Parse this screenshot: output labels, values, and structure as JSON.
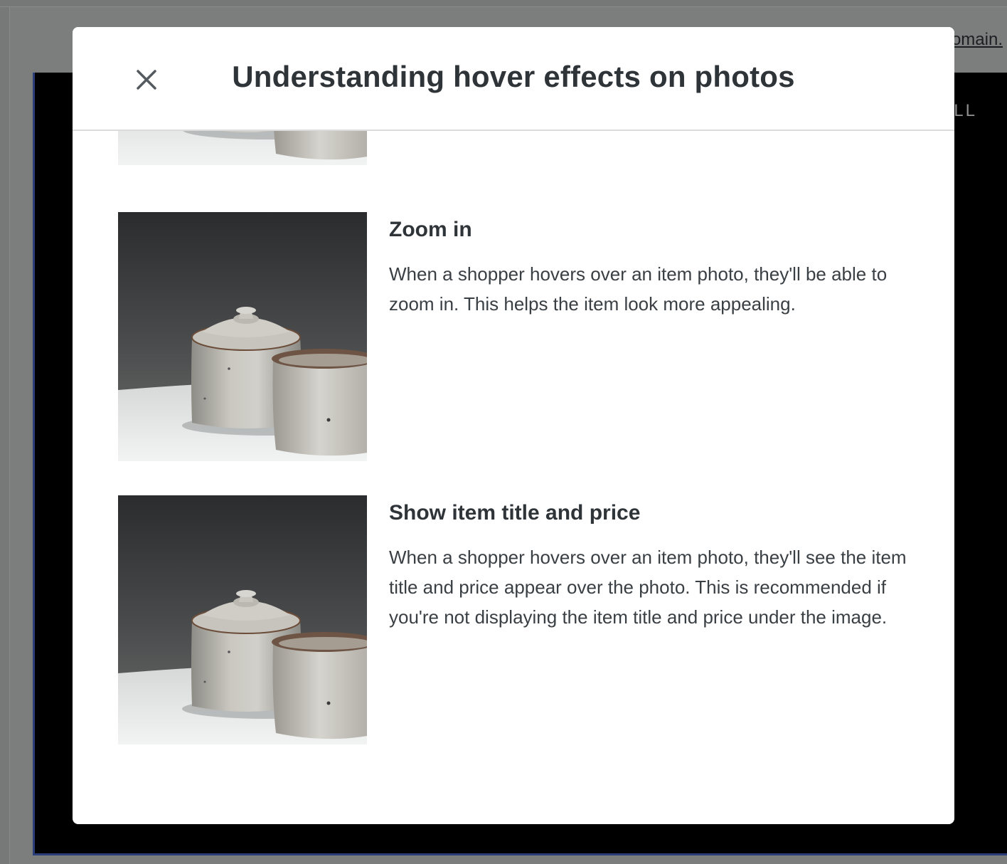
{
  "background": {
    "link_text": "omain.",
    "panel_text": "LL"
  },
  "modal": {
    "title": "Understanding hover effects on photos",
    "close_icon": "close-icon",
    "effects": [
      {
        "title": "Zoom in",
        "description": "When a shopper hovers over an item photo, they'll be able to zoom in. This helps the item look more appealing."
      },
      {
        "title": "Show item title and price",
        "description": "When a shopper hovers over an item photo, they'll see the item title and price appear over the photo. This is recommended if you're not displaying the item title and price under the image."
      }
    ]
  },
  "colors": {
    "overlay": "#7c7e7e",
    "text_primary": "#2f3439",
    "panel_bg": "#000000",
    "panel_border": "#2a3f7a"
  }
}
